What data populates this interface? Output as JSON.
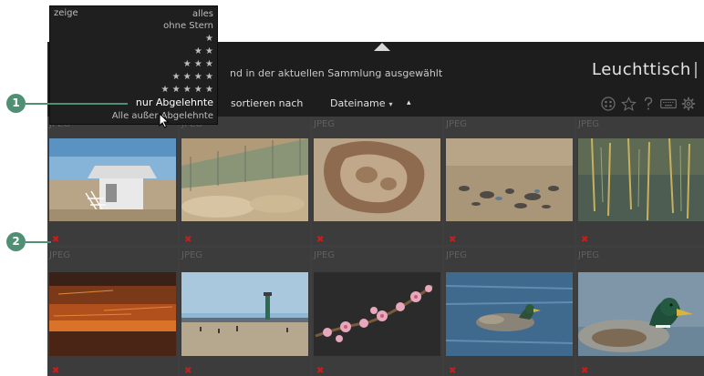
{
  "window": {
    "count_text": "nd in der aktuellen Sammlung ausgewählt",
    "view_title": "Leuchttisch",
    "sort_label": "sortieren nach",
    "sort_value": "Dateiname",
    "sort_caret": "▾",
    "sort_direction": "▴",
    "toolbar_icons": [
      "grouping-icon",
      "star-overlay-icon",
      "help-icon",
      "keyboard-icon",
      "gear-icon"
    ]
  },
  "filter_dropdown": {
    "label": "zeige",
    "options": [
      {
        "label": "alles"
      },
      {
        "label": "ohne Stern"
      },
      {
        "label": "★"
      },
      {
        "label": "★ ★"
      },
      {
        "label": "★ ★ ★"
      },
      {
        "label": "★ ★ ★ ★"
      },
      {
        "label": "★ ★ ★ ★ ★"
      },
      {
        "label": "nur Abgelehnte",
        "highlighted": true
      },
      {
        "label": "Alle außer Abgelehnte"
      }
    ]
  },
  "thumbnails": [
    {
      "ext": "JPEG",
      "subject": "beach-hut"
    },
    {
      "ext": "JPEG",
      "subject": "dunes-fence"
    },
    {
      "ext": "JPEG",
      "subject": "sand-pattern"
    },
    {
      "ext": "JPEG",
      "subject": "pebble-beach"
    },
    {
      "ext": "JPEG",
      "subject": "reeds-water"
    },
    {
      "ext": "JPEG",
      "subject": "sunset-sky"
    },
    {
      "ext": "JPEG",
      "subject": "pier-lighthouse"
    },
    {
      "ext": "JPEG",
      "subject": "blossom-branch"
    },
    {
      "ext": "JPEG",
      "subject": "swimming-duck"
    },
    {
      "ext": "JPEG",
      "subject": "mallard-closeup"
    }
  ],
  "reject_mark": "✖",
  "callouts": [
    "1",
    "2"
  ],
  "colors": {
    "callout": "#4f8f74",
    "reject": "#cc1c1c",
    "topbar": "#1d1d1d",
    "grid_bg": "#3f3f3f"
  }
}
